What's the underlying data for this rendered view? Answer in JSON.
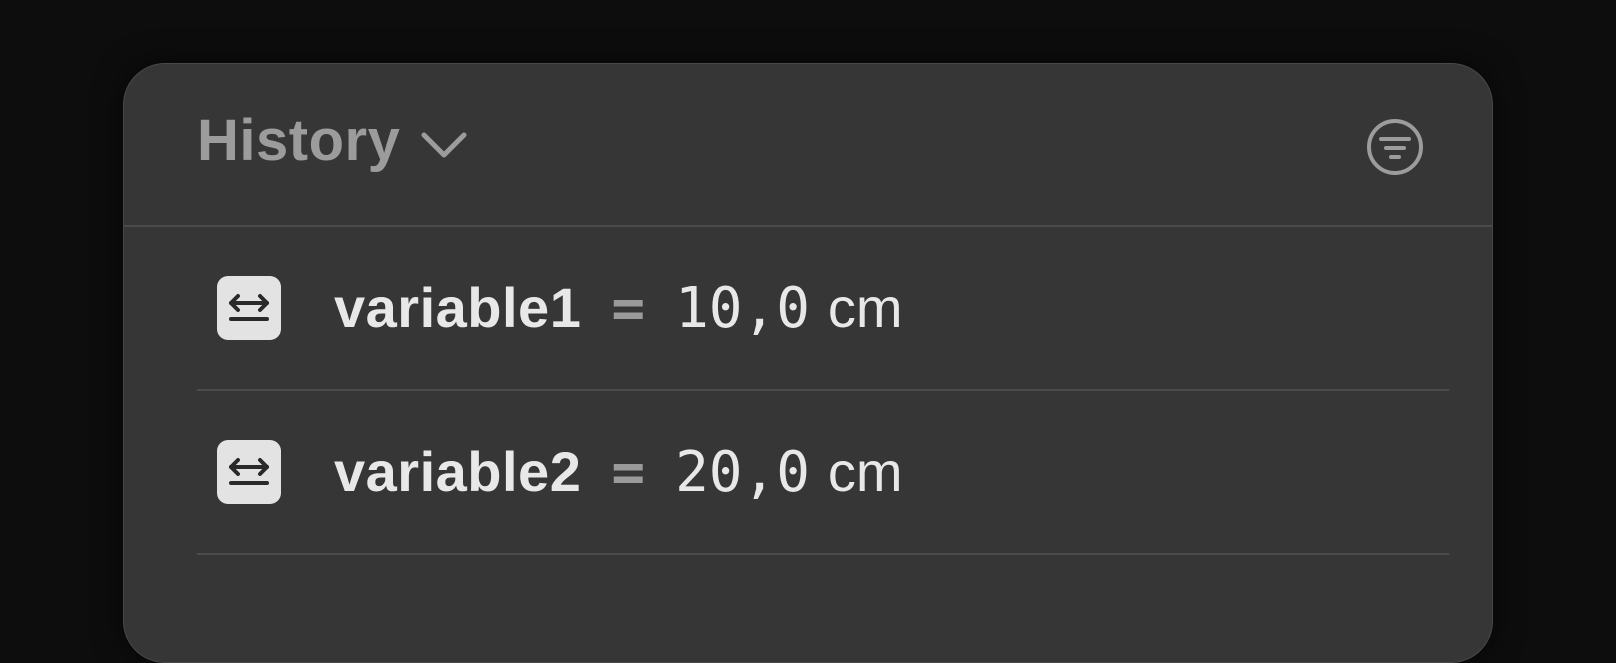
{
  "header": {
    "title": "History",
    "dropdown_icon": "chevron-down-icon",
    "filter_icon": "filter-icon"
  },
  "history": {
    "items": [
      {
        "icon": "length-measure-icon",
        "name": "variable1",
        "operator": "=",
        "value": "10,0",
        "unit": "cm"
      },
      {
        "icon": "length-measure-icon",
        "name": "variable2",
        "operator": "=",
        "value": "20,0",
        "unit": "cm"
      }
    ]
  },
  "colors": {
    "background": "#0d0d0d",
    "panel": "#363636",
    "title_text": "#9c9c9c",
    "row_text": "#e8e8e8",
    "icon_bg": "#e3e3e3"
  }
}
